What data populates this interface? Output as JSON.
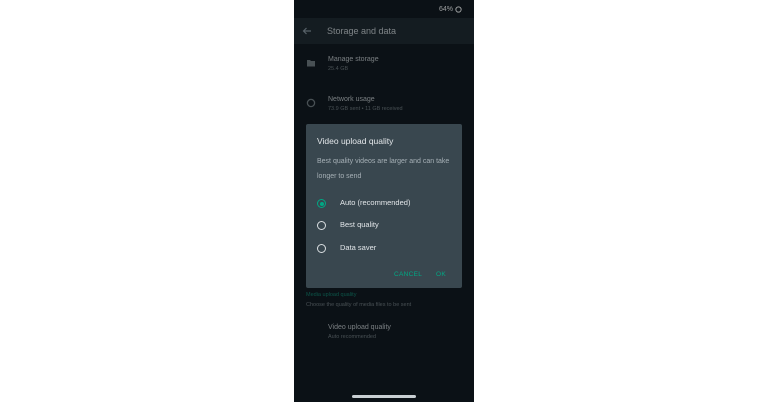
{
  "status_bar": {
    "battery": "64%"
  },
  "app_bar": {
    "title": "Storage and data"
  },
  "rows": {
    "manage_storage": {
      "title": "Manage storage",
      "subtitle": "25.4 GB"
    },
    "network_usage": {
      "title": "Network usage",
      "subtitle": "73.9 GB sent • 11 GB received"
    }
  },
  "media_upload": {
    "header": "Media upload quality",
    "description": "Choose the quality of media files to be sent",
    "video_row": {
      "title": "Video upload quality",
      "subtitle": "Auto recommended"
    }
  },
  "dialog": {
    "title": "Video upload quality",
    "message": "Best quality videos are larger and can take longer to send",
    "options": [
      {
        "label": "Auto (recommended)",
        "selected": true
      },
      {
        "label": "Best quality",
        "selected": false
      },
      {
        "label": "Data saver",
        "selected": false
      }
    ],
    "cancel_label": "CANCEL",
    "ok_label": "OK"
  },
  "colors": {
    "accent": "#00a884",
    "background": "#121b22",
    "dialog": "#39474f"
  }
}
